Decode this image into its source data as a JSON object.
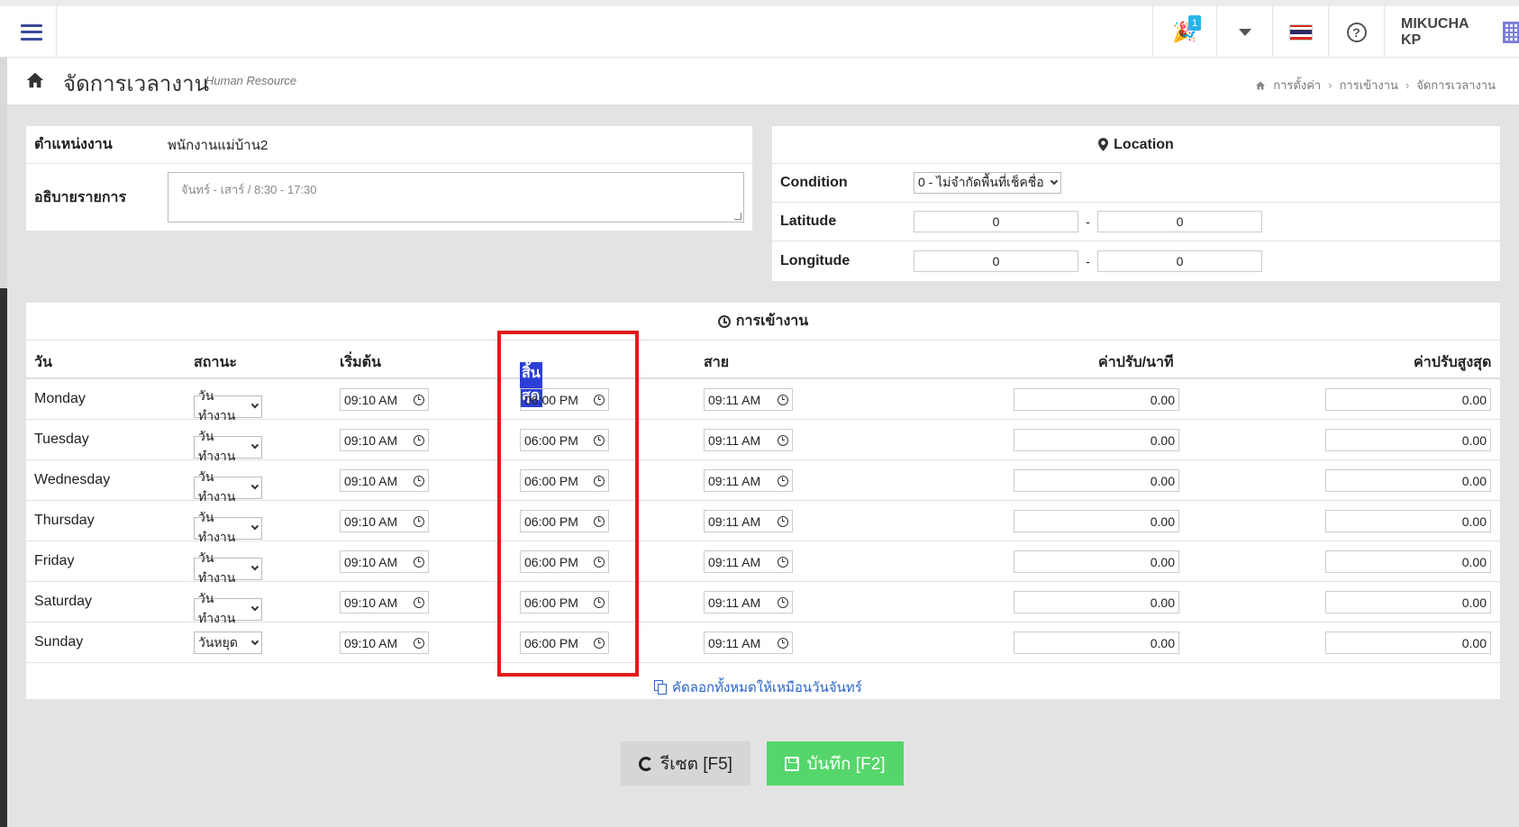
{
  "topbar": {
    "notification_count": "1",
    "user_name": "MIKUCHA KP"
  },
  "title": {
    "main": "จัดการเวลางาน",
    "sub": "Human Resource"
  },
  "breadcrumb": [
    "การตั้งค่า",
    "การเข้างาน",
    "จัดการเวลางาน"
  ],
  "job": {
    "position_label": "ตำแหน่งงาน",
    "position_value": "พนักงานแม่บ้าน2",
    "desc_label": "อธิบายรายการ",
    "desc_placeholder": "จันทร์ - เสาร์ / 8:30 - 17:30"
  },
  "location": {
    "title": "Location",
    "condition_label": "Condition",
    "condition_value": "0 - ไม่จำกัดพื้นที่เช็คชื่อ",
    "latitude_label": "Latitude",
    "latitude_from": "0",
    "latitude_to": "0",
    "longitude_label": "Longitude",
    "longitude_from": "0",
    "longitude_to": "0",
    "dash": "-"
  },
  "attendance": {
    "title": "การเข้างาน",
    "headers": {
      "day": "วัน",
      "status": "สถานะ",
      "start": "เริ่มต้น",
      "end": "สิ้นสุด",
      "late": "สาย",
      "fine_per_min": "ค่าปรับ/นาที",
      "fine_max": "ค่าปรับสูงสุด"
    },
    "rows": [
      {
        "day": "Monday",
        "status": "วันทำงาน",
        "start": "09:10 AM",
        "end": "06:00 PM",
        "late": "09:11 AM",
        "fine": "0.00",
        "fine_max": "0.00"
      },
      {
        "day": "Tuesday",
        "status": "วันทำงาน",
        "start": "09:10 AM",
        "end": "06:00 PM",
        "late": "09:11 AM",
        "fine": "0.00",
        "fine_max": "0.00"
      },
      {
        "day": "Wednesday",
        "status": "วันทำงาน",
        "start": "09:10 AM",
        "end": "06:00 PM",
        "late": "09:11 AM",
        "fine": "0.00",
        "fine_max": "0.00"
      },
      {
        "day": "Thursday",
        "status": "วันทำงาน",
        "start": "09:10 AM",
        "end": "06:00 PM",
        "late": "09:11 AM",
        "fine": "0.00",
        "fine_max": "0.00"
      },
      {
        "day": "Friday",
        "status": "วันทำงาน",
        "start": "09:10 AM",
        "end": "06:00 PM",
        "late": "09:11 AM",
        "fine": "0.00",
        "fine_max": "0.00"
      },
      {
        "day": "Saturday",
        "status": "วันทำงาน",
        "start": "09:10 AM",
        "end": "06:00 PM",
        "late": "09:11 AM",
        "fine": "0.00",
        "fine_max": "0.00"
      },
      {
        "day": "Sunday",
        "status": "วันหยุด",
        "start": "09:10 AM",
        "end": "06:00 PM",
        "late": "09:11 AM",
        "fine": "0.00",
        "fine_max": "0.00"
      }
    ],
    "copy_link": "คัดลอกทั้งหมดให้เหมือนวันจันทร์"
  },
  "buttons": {
    "reset": "รีเซต [F5]",
    "save": "บันทึก [F2]"
  },
  "colors": {
    "accent": "#3a4a9a",
    "save": "#55d66a",
    "highlight": "#e01b1b",
    "link": "#2a63c4"
  }
}
